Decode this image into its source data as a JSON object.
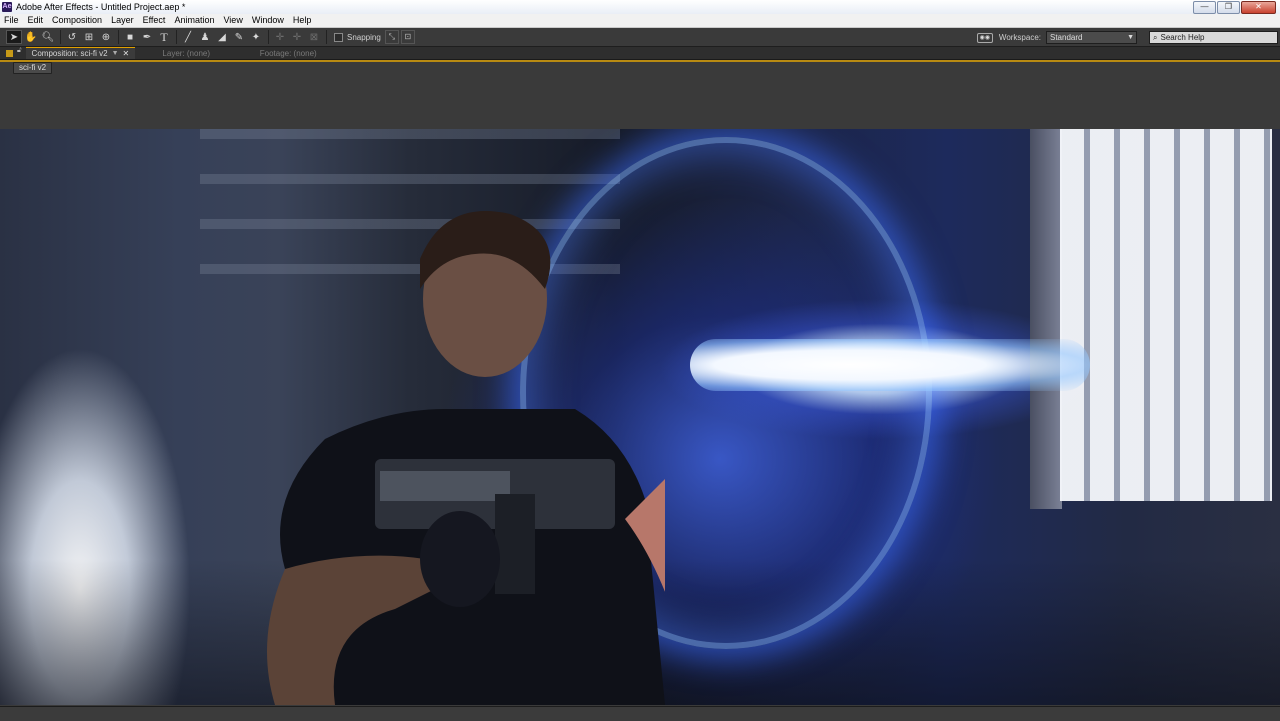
{
  "window": {
    "app_icon_text": "Ae",
    "title": "Adobe After Effects - Untitled Project.aep *",
    "buttons": {
      "minimize": "—",
      "maximize": "❐",
      "close": "✕"
    }
  },
  "menubar": {
    "items": [
      "File",
      "Edit",
      "Composition",
      "Layer",
      "Effect",
      "Animation",
      "View",
      "Window",
      "Help"
    ]
  },
  "toolbar": {
    "tools": [
      "selection-tool",
      "hand-tool",
      "zoom-tool",
      "rotation-tool",
      "camera-tool",
      "pan-behind-tool",
      "rectangle-tool",
      "pen-tool",
      "type-tool",
      "brush-tool",
      "clone-stamp-tool",
      "eraser-tool",
      "roto-brush-tool",
      "puppet-pin-tool"
    ],
    "snapping_label": "Snapping",
    "workspace_label": "Workspace:",
    "workspace_value": "Standard",
    "search_placeholder": "Search Help"
  },
  "panels": {
    "composition_tab": "Composition: sci-fi v2",
    "layer_tab": "Layer: (none)",
    "footage_tab": "Footage: (none)",
    "comp_nav_label": "sci-fi v2"
  },
  "colors": {
    "panel_accent": "#c79a18",
    "energy": "#3f6bff",
    "beam": "#f3f8ff"
  }
}
